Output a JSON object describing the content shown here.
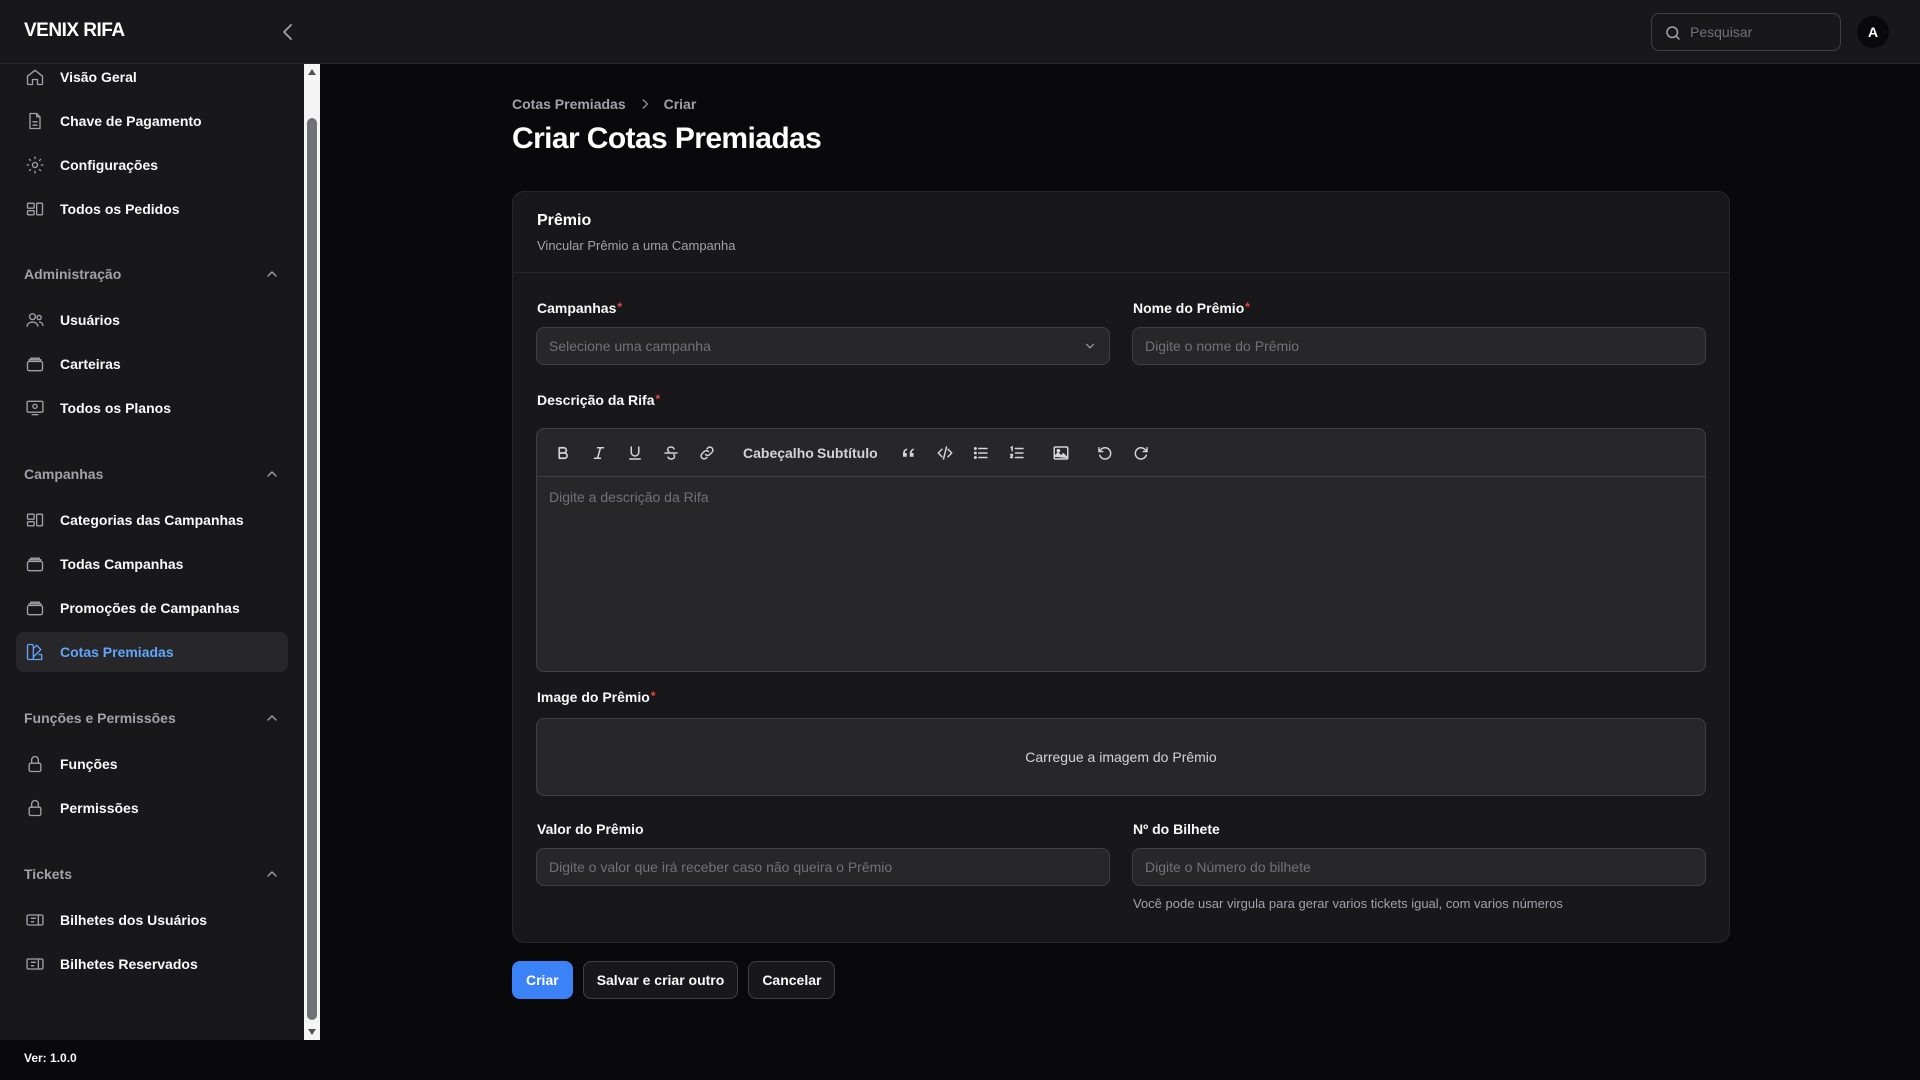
{
  "app": {
    "brand": "VENIX RIFA",
    "version": "Ver: 1.0.0"
  },
  "topbar": {
    "search_placeholder": "Pesquisar",
    "avatar_initial": "A"
  },
  "sidebar": {
    "top_items": [
      {
        "label": "Visão Geral",
        "icon": "home-icon"
      },
      {
        "label": "Chave de Pagamento",
        "icon": "document-icon"
      },
      {
        "label": "Configurações",
        "icon": "gear-icon"
      },
      {
        "label": "Todos os Pedidos",
        "icon": "layout-icon"
      }
    ],
    "groups": [
      {
        "title": "Administração",
        "items": [
          {
            "label": "Usuários",
            "icon": "users-icon"
          },
          {
            "label": "Carteiras",
            "icon": "stack-icon"
          },
          {
            "label": "Todos os Planos",
            "icon": "screen-user-icon"
          }
        ]
      },
      {
        "title": "Campanhas",
        "items": [
          {
            "label": "Categorias das Campanhas",
            "icon": "layout-icon"
          },
          {
            "label": "Todas Campanhas",
            "icon": "stack-icon"
          },
          {
            "label": "Promoções de Campanhas",
            "icon": "stack-icon"
          },
          {
            "label": "Cotas Premiadas",
            "icon": "color-swatch-icon",
            "active": true
          }
        ]
      },
      {
        "title": "Funções e Permissões",
        "items": [
          {
            "label": "Funções",
            "icon": "lock-icon"
          },
          {
            "label": "Permissões",
            "icon": "lock-icon"
          }
        ]
      },
      {
        "title": "Tickets",
        "items": [
          {
            "label": "Bilhetes dos Usuários",
            "icon": "ticket-icon"
          },
          {
            "label": "Bilhetes Reservados",
            "icon": "ticket-icon"
          }
        ]
      }
    ]
  },
  "breadcrumb": {
    "parent": "Cotas Premiadas",
    "current": "Criar"
  },
  "page": {
    "title": "Criar Cotas Premiadas"
  },
  "form": {
    "section_title": "Prêmio",
    "section_subtitle": "Vincular Prêmio a uma Campanha",
    "campanhas": {
      "label": "Campanhas",
      "placeholder": "Selecione uma campanha"
    },
    "nome": {
      "label": "Nome do Prêmio",
      "placeholder": "Digite o nome do Prêmio"
    },
    "descricao": {
      "label": "Descrição da Rifa",
      "placeholder": "Digite a descrição da Rifa",
      "toolbar": {
        "heading": "Cabeçalho",
        "subheading": "Subtítulo"
      }
    },
    "imagem": {
      "label": "Image do Prêmio",
      "upload_text": "Carregue a imagem do Prêmio"
    },
    "valor": {
      "label": "Valor do Prêmio",
      "placeholder": "Digite o valor que irá receber caso não queira o Prêmio"
    },
    "bilhete": {
      "label": "Nº do Bilhete",
      "placeholder": "Digite o Número do bilhete",
      "help": "Você pode usar virgula para gerar varios tickets igual, com varios números"
    },
    "required_mark": "*"
  },
  "actions": {
    "create": "Criar",
    "save_and_create": "Salvar e criar outro",
    "cancel": "Cancelar"
  },
  "colors": {
    "accent": "#3b82f6",
    "active_nav": "#60a5fa",
    "required": "#ef4444"
  }
}
